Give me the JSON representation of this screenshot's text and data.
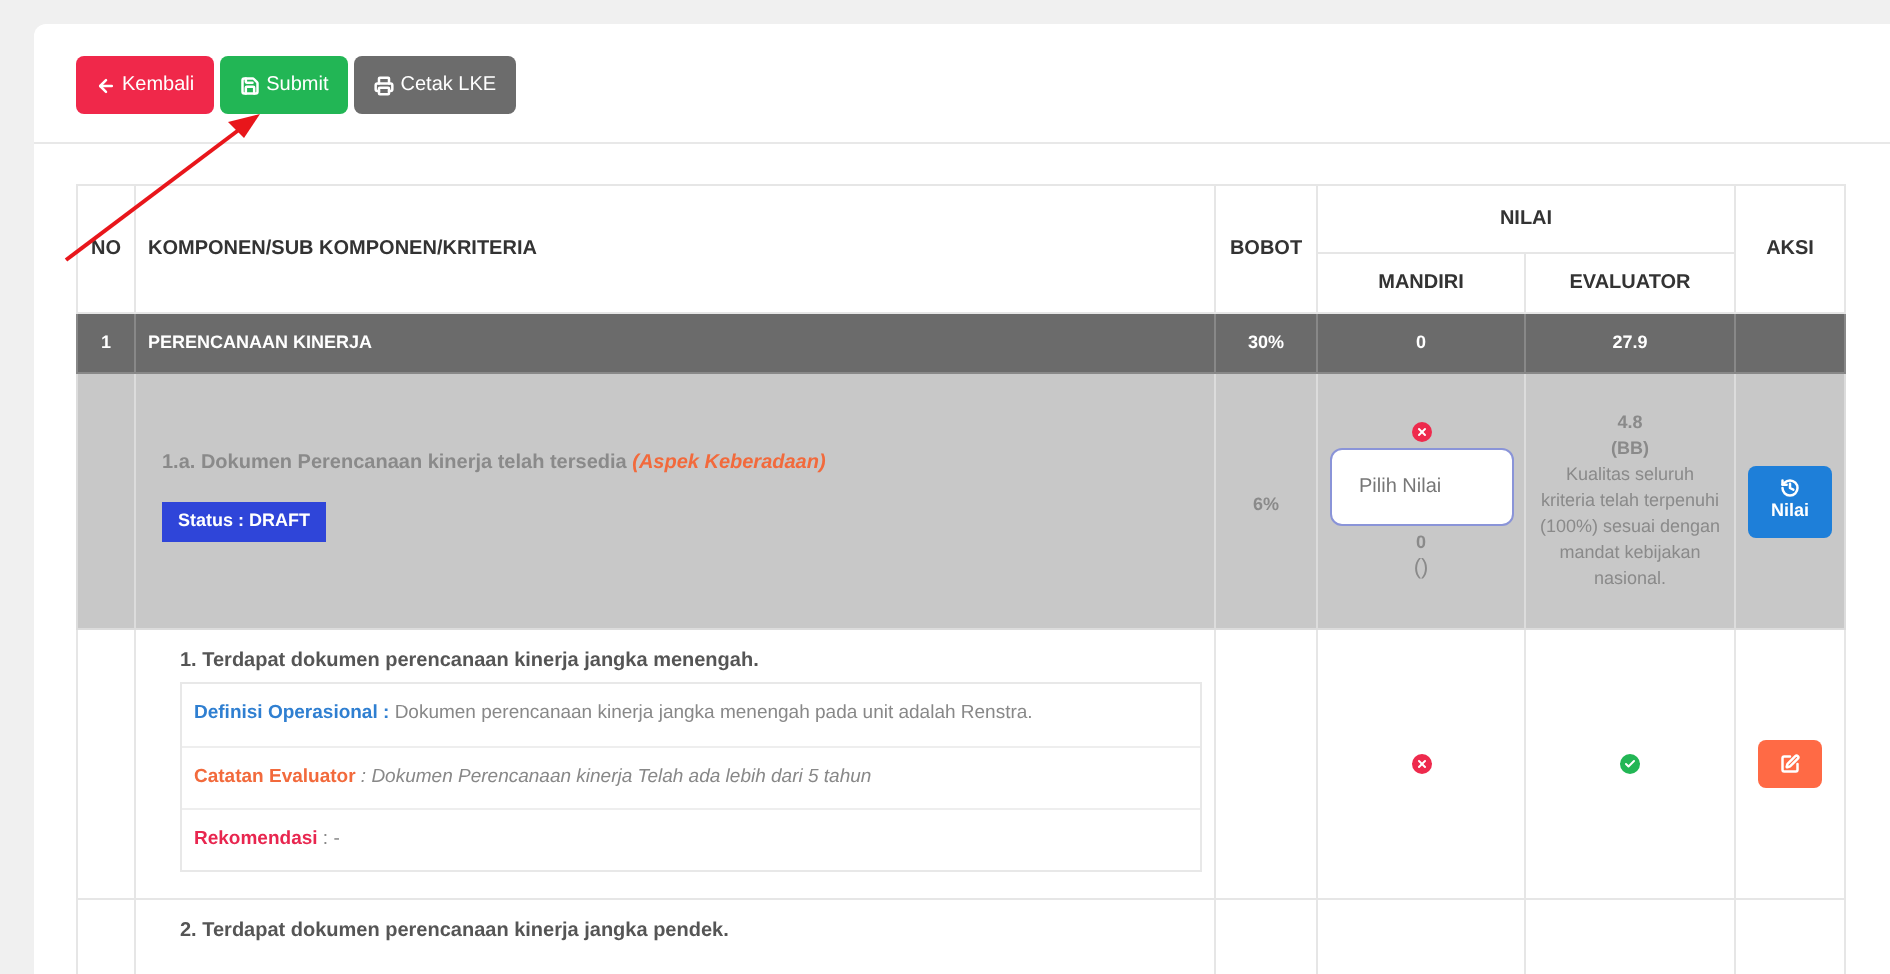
{
  "toolbar": {
    "buttons": [
      {
        "kind": "back",
        "label": "Kembali"
      },
      {
        "kind": "submit",
        "label": "Submit"
      },
      {
        "kind": "print",
        "label": "Cetak LKE"
      }
    ]
  },
  "table": {
    "columns": {
      "no": "NO",
      "criteria": "KOMPONEN/SUB KOMPONEN/KRITERIA",
      "weight": "BOBOT",
      "score": "NILAI",
      "self": "MANDIRI",
      "evaluator": "EVALUATOR",
      "action": "AKSI"
    },
    "component": {
      "no": "1",
      "name": "PERENCANAAN KINERJA",
      "weight": "30%",
      "self": "0",
      "evaluator": "27.9"
    },
    "sub_component": {
      "title": "1.a. Dokumen Perencanaan kinerja telah tersedia",
      "aspect": "(Aspek Keberadaan)",
      "status": "Status : DRAFT",
      "weight": "6%",
      "self_icon": {
        "kind": "cross"
      },
      "select_placeholder": "Pilih Nilai",
      "self_score": "0",
      "self_grade": "()",
      "evaluator_score": "4.8",
      "evaluator_grade": "(BB)",
      "evaluator_note": "Kualitas seluruh kriteria telah terpenuhi (100%) sesuai dengan mandat kebijakan nasional.",
      "action": "Nilai"
    },
    "criteria": [
      {
        "title": "1. Terdapat dokumen perencanaan kinerja jangka menengah.",
        "details": [
          {
            "kind": "definition",
            "label": "Definisi Operasional :",
            "text": "Dokumen perencanaan kinerja jangka menengah pada unit adalah Renstra."
          },
          {
            "kind": "note",
            "label": "Catatan Evaluator",
            "text": ": Dokumen Perencanaan kinerja Telah ada lebih dari 5 tahun"
          },
          {
            "kind": "recommendation",
            "label": "Rekomendasi",
            "text": ": -"
          }
        ],
        "self_icon": {
          "kind": "cross"
        },
        "evaluator_icon": {
          "kind": "check"
        },
        "action_button": {
          "kind": "edit"
        }
      },
      {
        "title": "2. Terdapat dokumen perencanaan kinerja jangka pendek."
      }
    ]
  }
}
